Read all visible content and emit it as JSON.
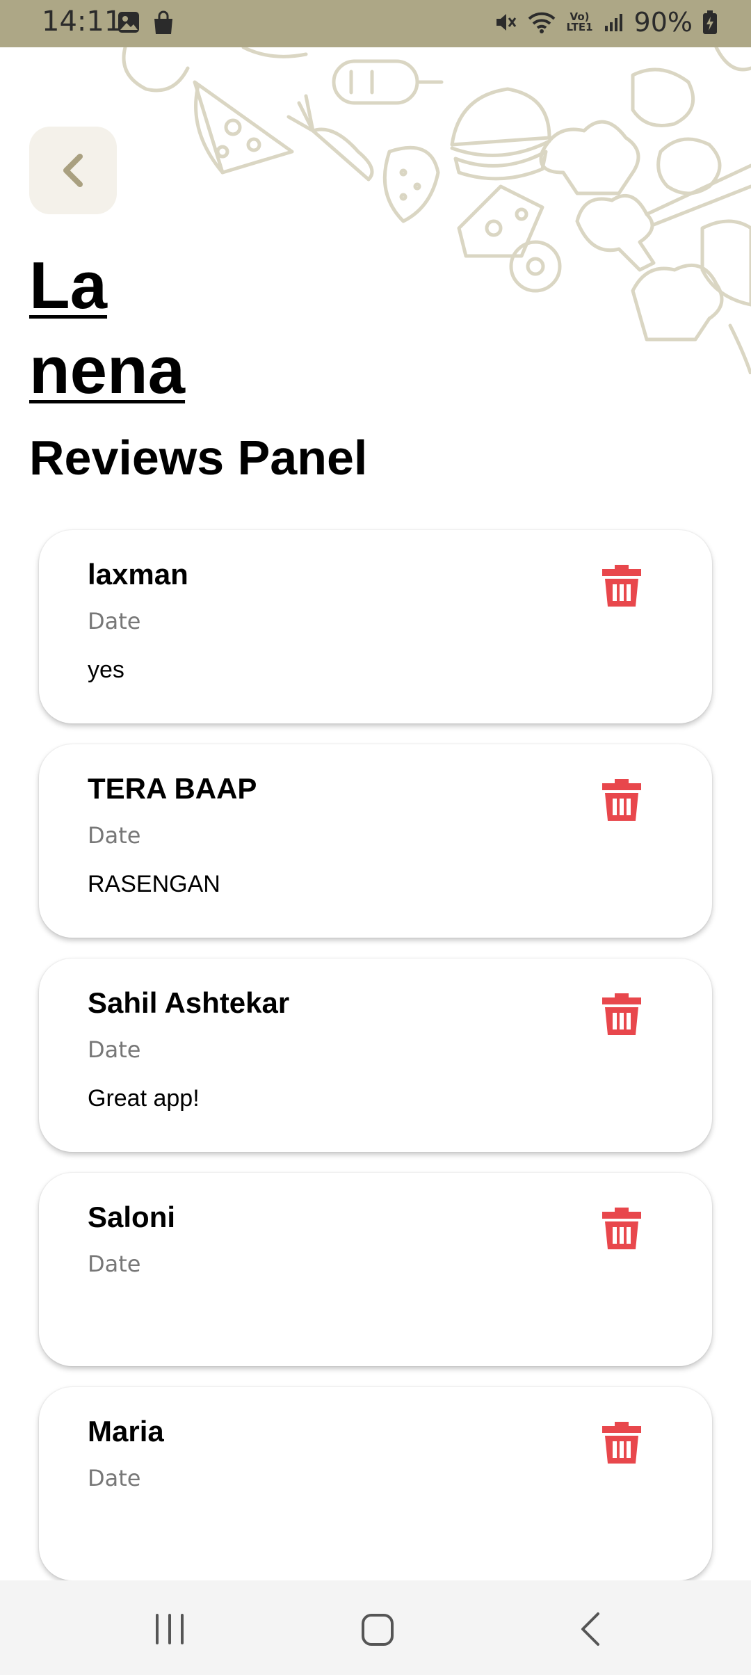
{
  "status_bar": {
    "time": "14:11",
    "battery": "90%",
    "network_label": "Vo) LTE1",
    "icons": [
      "gallery-icon",
      "shopping-bag-icon",
      "mute-icon",
      "wifi-icon",
      "signal-icon",
      "battery-icon"
    ]
  },
  "header": {
    "back_icon": "chevron-left-icon",
    "title": "La nena",
    "subtitle": "Reviews Panel"
  },
  "reviews": [
    {
      "name": "laxman",
      "date": "Date",
      "text": "yes"
    },
    {
      "name": "TERA BAAP",
      "date": "Date",
      "text": "RASENGAN"
    },
    {
      "name": "Sahil Ashtekar",
      "date": "Date",
      "text": "Great app!"
    },
    {
      "name": "Saloni",
      "date": "Date",
      "text": ""
    },
    {
      "name": "Maria",
      "date": "Date",
      "text": ""
    }
  ],
  "colors": {
    "status_bar": "#ADA786",
    "accent": "#A9A080",
    "delete": "#E8474C",
    "doodle": "#DAD6C3"
  },
  "navbar": {
    "icons": [
      "recent-apps-icon",
      "home-icon",
      "back-icon"
    ]
  }
}
